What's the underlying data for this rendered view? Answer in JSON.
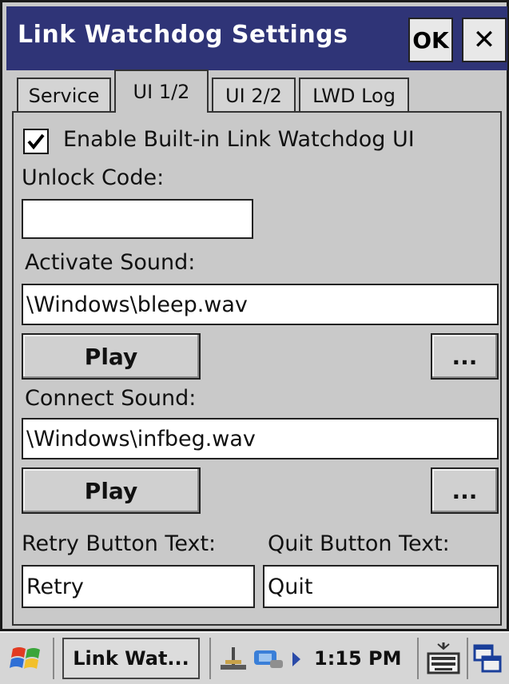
{
  "window": {
    "title": "Link Watchdog Settings",
    "ok_label": "OK",
    "close_label": "✕"
  },
  "tabs": [
    {
      "label": "Service",
      "active": false
    },
    {
      "label": "UI 1/2",
      "active": true
    },
    {
      "label": "UI 2/2",
      "active": false
    },
    {
      "label": "LWD Log",
      "active": false
    }
  ],
  "form": {
    "enable_ui": {
      "label": "Enable Built-in Link Watchdog UI",
      "checked": true
    },
    "unlock_code": {
      "label": "Unlock Code:",
      "value": ""
    },
    "activate_sound": {
      "label": "Activate Sound:",
      "value": "\\Windows\\bleep.wav",
      "play_label": "Play",
      "browse_label": "..."
    },
    "connect_sound": {
      "label": "Connect Sound:",
      "value": "\\Windows\\infbeg.wav",
      "play_label": "Play",
      "browse_label": "..."
    },
    "retry_text": {
      "label": "Retry Button Text:",
      "value": "Retry"
    },
    "quit_text": {
      "label": "Quit Button Text:",
      "value": "Quit"
    }
  },
  "taskbar": {
    "start_icon": "windows-flag-icon",
    "task_label": "Link Wat...",
    "time": "1:15 PM",
    "keyboard_icon": "keyboard-icon",
    "switch_icon": "window-switch-icon",
    "tray_icons": [
      "network-icon",
      "connectivity-icon",
      "tray-arrow-icon"
    ]
  }
}
